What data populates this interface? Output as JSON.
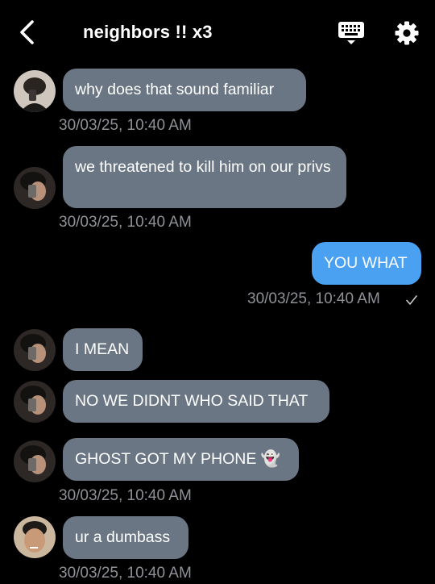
{
  "header": {
    "title": "neighbors !! x3",
    "back_icon": "chevron-left-icon",
    "keyboard_icon": "keyboard-icon",
    "settings_icon": "gear-icon"
  },
  "colors": {
    "background": "#000000",
    "incoming_bubble": "#6a7684",
    "outgoing_bubble": "#4aa0f1",
    "timestamp": "#8e9196"
  },
  "messages": [
    {
      "direction": "in",
      "text": "why does that sound familiar",
      "timestamp": "30/03/25, 10:40 AM"
    },
    {
      "direction": "in",
      "text": "we threatened to kill him on our privs",
      "timestamp": "30/03/25, 10:40 AM"
    },
    {
      "direction": "out",
      "text": "YOU WHAT",
      "timestamp": "30/03/25, 10:40 AM",
      "status_icon": "checkmark-icon"
    },
    {
      "direction": "in",
      "text": "I MEAN"
    },
    {
      "direction": "in",
      "text": "NO WE DIDNT WHO SAID THAT"
    },
    {
      "direction": "in",
      "text": "GHOST GOT MY PHONE 👻",
      "timestamp": "30/03/25, 10:40 AM"
    },
    {
      "direction": "in",
      "text": "ur a dumbass",
      "timestamp": "30/03/25, 10:40 AM"
    }
  ]
}
